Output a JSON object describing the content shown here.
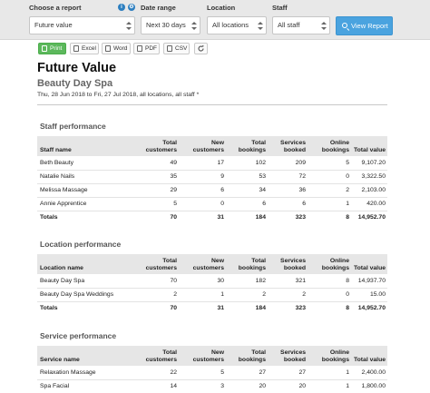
{
  "filters": {
    "report_label": "Choose a report",
    "report_value": "Future value",
    "date_label": "Date range",
    "date_value": "Next 30 days",
    "location_label": "Location",
    "location_value": "All locations",
    "staff_label": "Staff",
    "staff_value": "All staff",
    "view_button": "View Report",
    "info_glyph": "i",
    "gear_glyph": "⚙"
  },
  "toolbar": {
    "print": "Print",
    "excel": "Excel",
    "word": "Word",
    "pdf": "PDF",
    "csv": "CSV"
  },
  "report": {
    "title": "Future Value",
    "subtitle": "Beauty Day Spa",
    "dates": "Thu, 28 Jun 2018 to Fri, 27 Jul 2018, all locations, all staff *"
  },
  "columns": [
    "Total customers",
    "New customers",
    "Total bookings",
    "Services booked",
    "Online bookings",
    "Total value"
  ],
  "staff": {
    "title": "Staff performance",
    "header": "Staff name",
    "rows": [
      [
        "Beth Beauty",
        "49",
        "17",
        "102",
        "209",
        "5",
        "9,107.20"
      ],
      [
        "Natalie  Nails",
        "35",
        "9",
        "53",
        "72",
        "0",
        "3,322.50"
      ],
      [
        "Melissa Massage",
        "29",
        "6",
        "34",
        "36",
        "2",
        "2,103.00"
      ],
      [
        "Annie Apprentice",
        "5",
        "0",
        "6",
        "6",
        "1",
        "420.00"
      ]
    ],
    "total": [
      "Totals",
      "70",
      "31",
      "184",
      "323",
      "8",
      "14,952.70"
    ]
  },
  "location": {
    "title": "Location performance",
    "header": "Location name",
    "rows": [
      [
        "Beauty Day Spa",
        "70",
        "30",
        "182",
        "321",
        "8",
        "14,937.70"
      ],
      [
        "Beauty Day Spa Weddings",
        "2",
        "1",
        "2",
        "2",
        "0",
        "15.00"
      ]
    ],
    "total": [
      "Totals",
      "70",
      "31",
      "184",
      "323",
      "8",
      "14,952.70"
    ]
  },
  "service": {
    "title": "Service performance",
    "header": "Service name",
    "rows": [
      [
        "Relaxation Massage",
        "22",
        "5",
        "27",
        "27",
        "1",
        "2,400.00"
      ],
      [
        "Spa Facial",
        "14",
        "3",
        "20",
        "20",
        "1",
        "1,800.00"
      ]
    ]
  }
}
